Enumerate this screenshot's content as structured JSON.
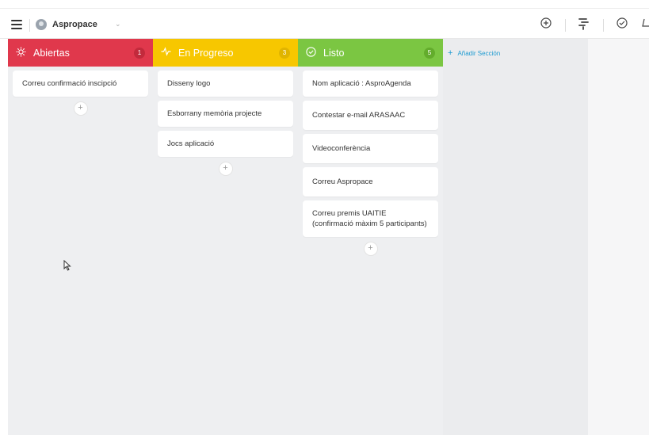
{
  "header": {
    "project_name": "Aspropace",
    "icons": [
      "menu-icon",
      "project-avatar-icon",
      "chevron-down-icon",
      "add-circle-icon",
      "filter-icon",
      "check-circle-icon"
    ]
  },
  "columns": [
    {
      "title": "Abiertas",
      "icon": "sun-icon",
      "count": "1",
      "color": "#e0384c",
      "cards": [
        "Correu confirmació inscipció"
      ]
    },
    {
      "title": "En Progreso",
      "icon": "activity-icon",
      "count": "3",
      "color": "#f7c700",
      "cards": [
        "Disseny logo",
        "Esborrany memòria projecte",
        "Jocs aplicació"
      ]
    },
    {
      "title": "Listo",
      "icon": "check-circle-icon",
      "count": "5",
      "color": "#7bc642",
      "cards": [
        "Nom aplicació : AsproAgenda",
        "Contestar e-mail ARASAAC",
        "Videoconferència",
        "Correu Aspropace",
        "Correu premis UAITIE (confirmació màxim 5 participants)"
      ]
    }
  ],
  "add_section": {
    "plus": "+",
    "label": "Añadir Sección",
    "color": "#1f9bd1"
  },
  "add_card_symbol": "+"
}
